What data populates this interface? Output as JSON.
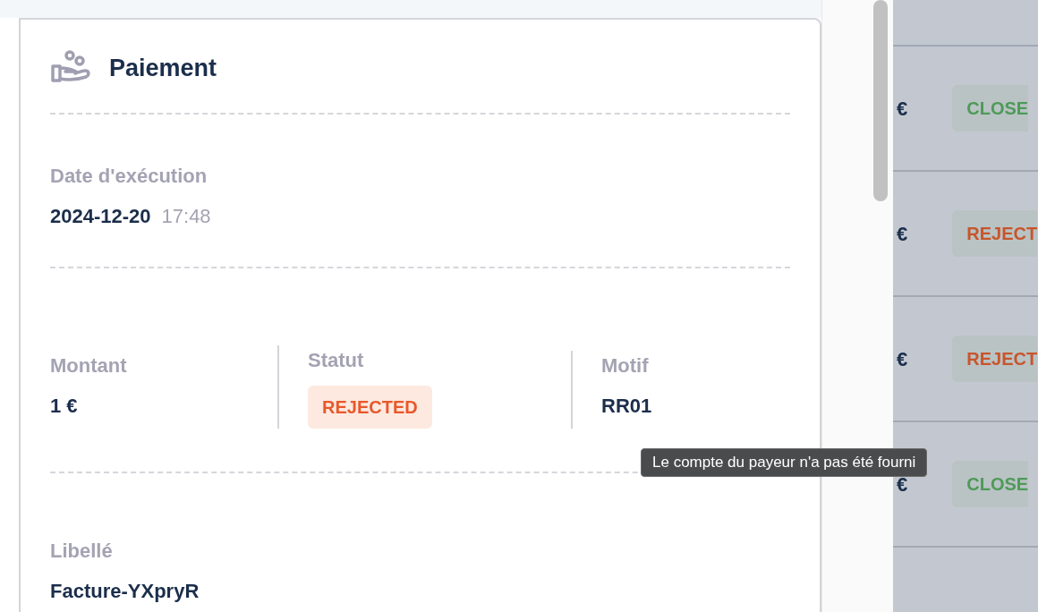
{
  "card": {
    "title": "Paiement",
    "execution": {
      "label": "Date d'exécution",
      "date": "2024-12-20",
      "time": "17:48"
    },
    "fields": [
      {
        "label": "Montant",
        "value": "1 €",
        "kind": "text"
      },
      {
        "label": "Statut",
        "value": "REJECTED",
        "kind": "badge"
      },
      {
        "label": "Motif",
        "value": "RR01",
        "kind": "text"
      }
    ],
    "libelle": {
      "label": "Libellé",
      "value": "Facture-YXpryR"
    }
  },
  "tooltip": "Le compte du payeur n'a pas été fourni",
  "table_rows": [
    {
      "amount": "€",
      "status": "CLOSE",
      "color": "#4e9a58"
    },
    {
      "amount": "€",
      "status": "REJECT",
      "color": "#c8552c"
    },
    {
      "amount": "€",
      "status": "REJECT",
      "color": "#c8552c"
    },
    {
      "amount": "€",
      "status": "CLOSE",
      "color": "#4e9a58"
    }
  ]
}
